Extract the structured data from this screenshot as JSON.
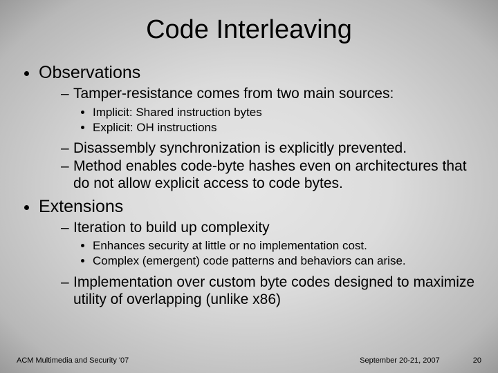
{
  "title": "Code Interleaving",
  "sections": [
    {
      "label": "Observations",
      "items": [
        {
          "text": "Tamper-resistance comes from two main sources:",
          "sub": [
            "Implicit: Shared instruction bytes",
            "Explicit: OH instructions"
          ]
        },
        {
          "text": "Disassembly synchronization is explicitly prevented.",
          "sub": []
        },
        {
          "text": "Method enables code-byte hashes even on architectures that do not allow explicit access to code bytes.",
          "sub": []
        }
      ]
    },
    {
      "label": "Extensions",
      "items": [
        {
          "text": "Iteration to build up complexity",
          "sub": [
            "Enhances security at little or no implementation cost.",
            "Complex (emergent) code patterns and behaviors can arise."
          ]
        },
        {
          "text": "Implementation over custom byte codes designed to maximize utility of overlapping (unlike x86)",
          "sub": []
        }
      ]
    }
  ],
  "footer": {
    "left": "ACM Multimedia and Security '07",
    "date": "September 20-21, 2007",
    "page": "20"
  }
}
